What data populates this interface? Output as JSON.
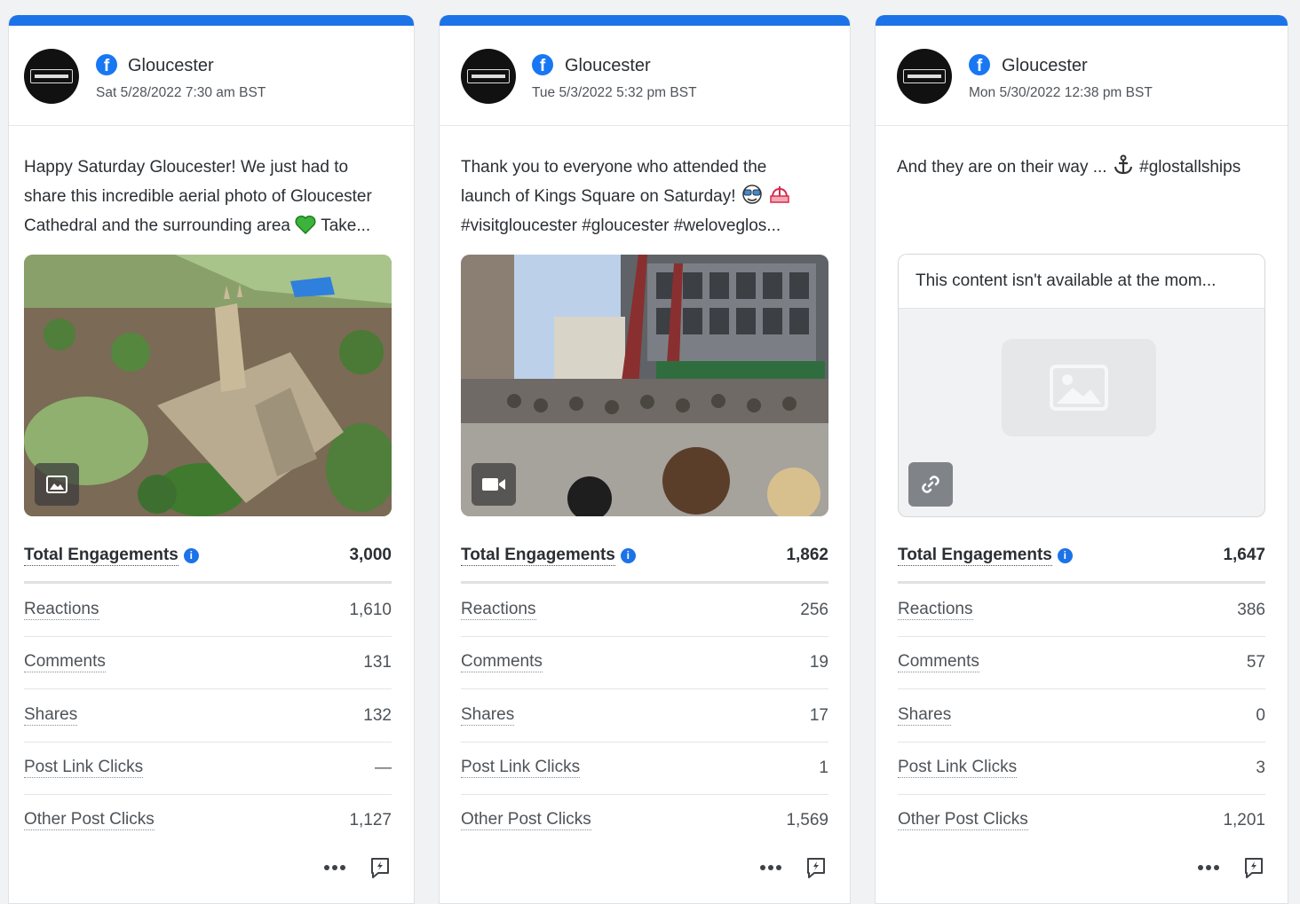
{
  "cards": [
    {
      "page_name": "Gloucester",
      "date": "Sat 5/28/2022 7:30 am BST",
      "text_lines": [
        "Happy Saturday Gloucester! We just had to",
        "share this incredible aerial photo of Gloucester",
        "Cathedral and the surrounding area",
        "Take..."
      ],
      "emoji": "green-heart-icon",
      "media_type": "photo",
      "media_icon": "image-icon",
      "metrics": {
        "total_label": "Total Engagements",
        "total_value": "3,000",
        "rows": [
          {
            "label": "Reactions",
            "value": "1,610"
          },
          {
            "label": "Comments",
            "value": "131"
          },
          {
            "label": "Shares",
            "value": "132"
          },
          {
            "label": "Post Link Clicks",
            "value": "—"
          },
          {
            "label": "Other Post Clicks",
            "value": "1,127"
          }
        ]
      }
    },
    {
      "page_name": "Gloucester",
      "date": "Tue 5/3/2022 5:32 pm BST",
      "text_lines": [
        "Thank you to everyone who attended the",
        "launch of Kings Square on Saturday!",
        "#visitgloucester #gloucester #weloveglos..."
      ],
      "emoji": "sunglasses-face-icon",
      "emoji2": "fountain-icon",
      "media_type": "video",
      "media_icon": "video-camera-icon",
      "metrics": {
        "total_label": "Total Engagements",
        "total_value": "1,862",
        "rows": [
          {
            "label": "Reactions",
            "value": "256"
          },
          {
            "label": "Comments",
            "value": "19"
          },
          {
            "label": "Shares",
            "value": "17"
          },
          {
            "label": "Post Link Clicks",
            "value": "1"
          },
          {
            "label": "Other Post Clicks",
            "value": "1,569"
          }
        ]
      }
    },
    {
      "page_name": "Gloucester",
      "date": "Mon 5/30/2022 12:38 pm BST",
      "text_before": "And they are on their way ...",
      "text_after": "#glostallships",
      "emoji": "anchor-icon",
      "unavailable_text": "This content isn't available at the mom...",
      "media_icon": "link-icon",
      "metrics": {
        "total_label": "Total Engagements",
        "total_value": "1,647",
        "rows": [
          {
            "label": "Reactions",
            "value": "386"
          },
          {
            "label": "Comments",
            "value": "57"
          },
          {
            "label": "Shares",
            "value": "0"
          },
          {
            "label": "Post Link Clicks",
            "value": "3"
          },
          {
            "label": "Other Post Clicks",
            "value": "1,201"
          }
        ]
      }
    }
  ],
  "colors": {
    "accent": "#1c73e8",
    "facebook": "#1877f2",
    "background": "#f1f2f3"
  }
}
